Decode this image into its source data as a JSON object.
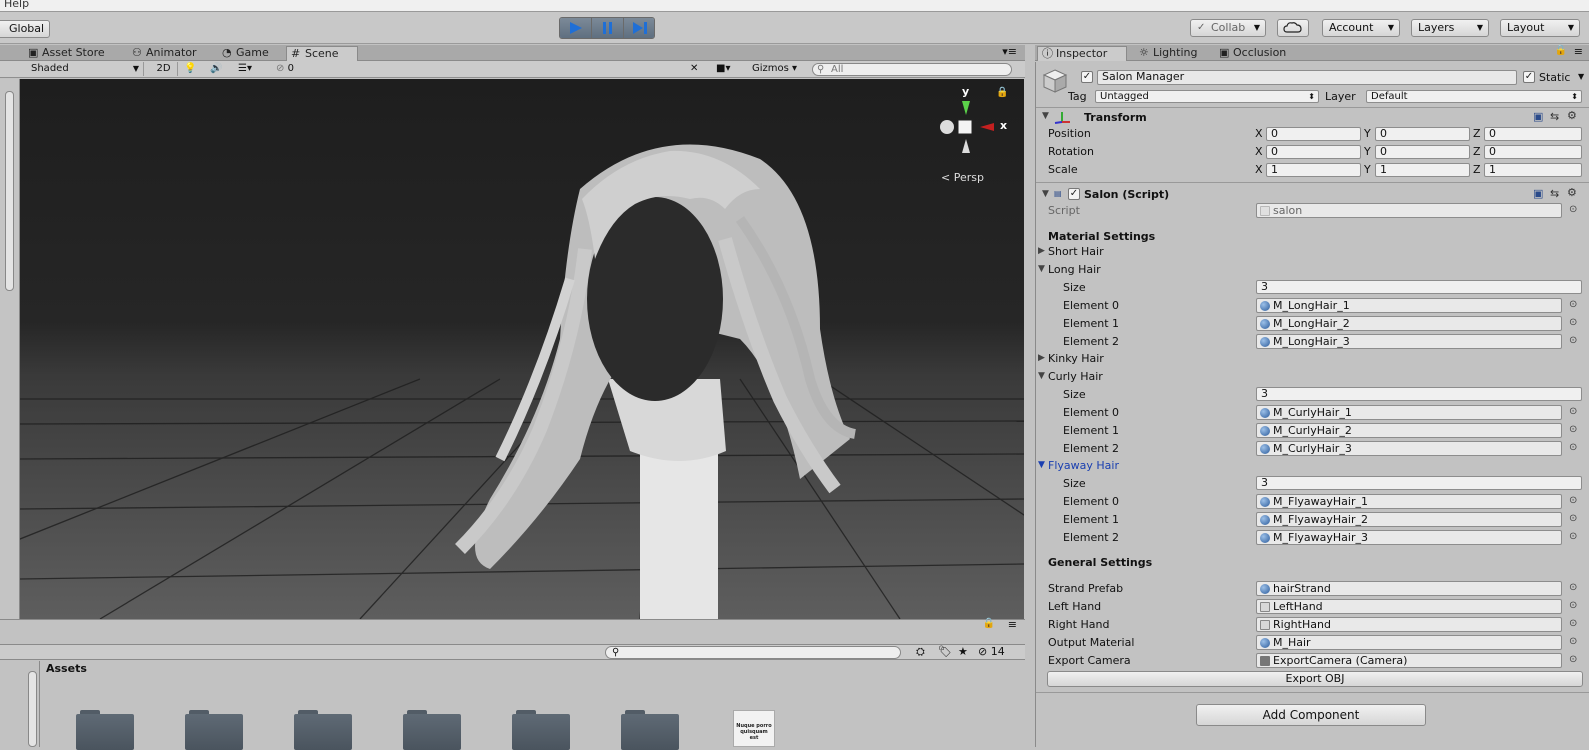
{
  "menubar": {
    "help": "Help"
  },
  "toolbar": {
    "global": "Global",
    "collab": "Collab",
    "account": "Account",
    "layers": "Layers",
    "layout": "Layout"
  },
  "scene_tabs": {
    "asset_store": "Asset Store",
    "animator": "Animator",
    "game": "Game",
    "scene": "Scene"
  },
  "scene_toolbar": {
    "shading": "Shaded",
    "mode_2d": "2D",
    "effects_count": "0",
    "gizmos": "Gizmos",
    "search_placeholder": "All"
  },
  "gizmo": {
    "y": "y",
    "x": "x",
    "persp": "Persp"
  },
  "project": {
    "assets_label": "Assets",
    "count": "14",
    "file_thumb": "Nuque porro quisquam est"
  },
  "inspector_tabs": {
    "inspector": "Inspector",
    "lighting": "Lighting",
    "occlusion": "Occlusion"
  },
  "inspector": {
    "object_name": "Salon Manager",
    "static_label": "Static",
    "tag_label": "Tag",
    "tag_value": "Untagged",
    "layer_label": "Layer",
    "layer_value": "Default",
    "transform": {
      "title": "Transform",
      "rows": [
        {
          "label": "Position",
          "x": "0",
          "y": "0",
          "z": "0"
        },
        {
          "label": "Rotation",
          "x": "0",
          "y": "0",
          "z": "0"
        },
        {
          "label": "Scale",
          "x": "1",
          "y": "1",
          "z": "1"
        }
      ],
      "axis_x": "X",
      "axis_y": "Y",
      "axis_z": "Z"
    },
    "script_component": {
      "title": "Salon (Script)",
      "script_label": "Script",
      "script_value": "salon",
      "material_settings": "Material Settings",
      "short_hair": "Short Hair",
      "long_hair": "Long Hair",
      "long_size_label": "Size",
      "long_size": "3",
      "long_elements": [
        {
          "label": "Element 0",
          "value": "M_LongHair_1"
        },
        {
          "label": "Element 1",
          "value": "M_LongHair_2"
        },
        {
          "label": "Element 2",
          "value": "M_LongHair_3"
        }
      ],
      "kinky_hair": "Kinky Hair",
      "curly_hair": "Curly Hair",
      "curly_size_label": "Size",
      "curly_size": "3",
      "curly_elements": [
        {
          "label": "Element 0",
          "value": "M_CurlyHair_1"
        },
        {
          "label": "Element 1",
          "value": "M_CurlyHair_2"
        },
        {
          "label": "Element 2",
          "value": "M_CurlyHair_3"
        }
      ],
      "flyaway_hair": "Flyaway Hair",
      "flyaway_size_label": "Size",
      "flyaway_size": "3",
      "flyaway_elements": [
        {
          "label": "Element 0",
          "value": "M_FlyawayHair_1"
        },
        {
          "label": "Element 1",
          "value": "M_FlyawayHair_2"
        },
        {
          "label": "Element 2",
          "value": "M_FlyawayHair_3"
        }
      ],
      "general_settings": "General Settings",
      "general": [
        {
          "label": "Strand Prefab",
          "value": "hairStrand"
        },
        {
          "label": "Left Hand",
          "value": "LeftHand"
        },
        {
          "label": "Right Hand",
          "value": "RightHand"
        },
        {
          "label": "Output Material",
          "value": "M_Hair"
        },
        {
          "label": "Export Camera",
          "value": "ExportCamera (Camera)"
        }
      ],
      "export_obj": "Export OBJ"
    },
    "add_component": "Add Component"
  },
  "colors": {
    "play_accent": "#1f6fd6",
    "foldout_active": "#1a3fb0"
  }
}
